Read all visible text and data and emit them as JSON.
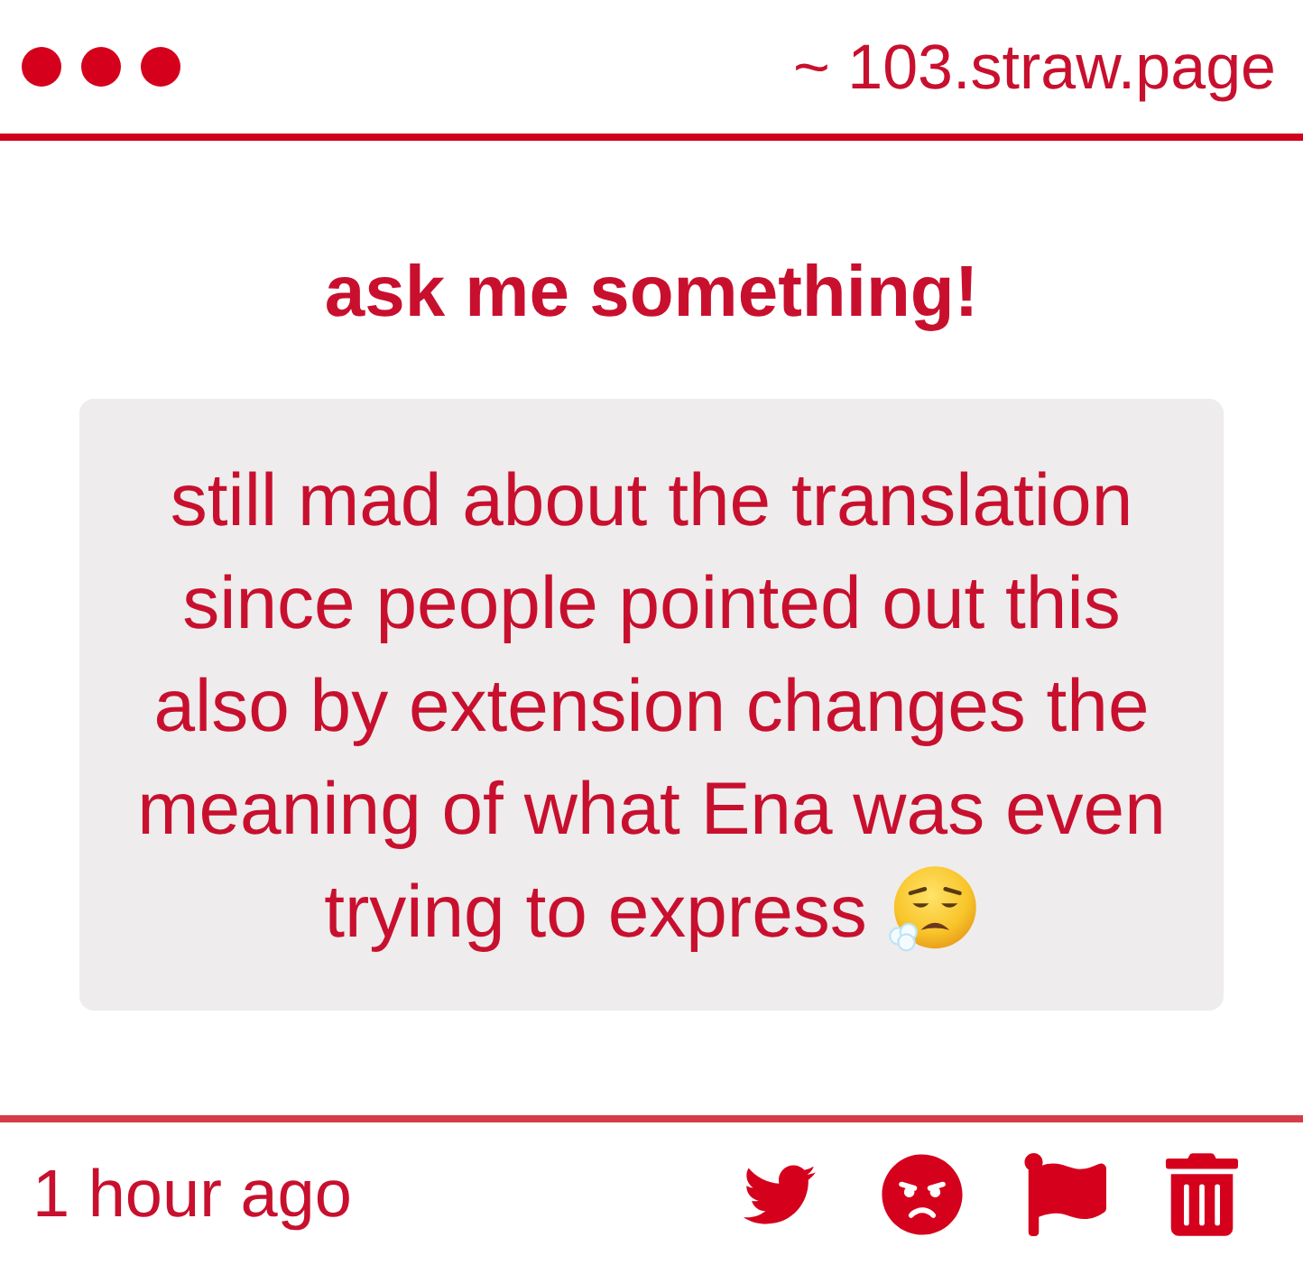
{
  "header": {
    "url": "~ 103.straw.page"
  },
  "prompt": {
    "title": "ask me something!"
  },
  "question": {
    "text": "still mad about the translation since people pointed out this also by extension changes the meaning of what Ena was even",
    "last_line": "trying to express"
  },
  "footer": {
    "time": "1 hour ago"
  }
}
